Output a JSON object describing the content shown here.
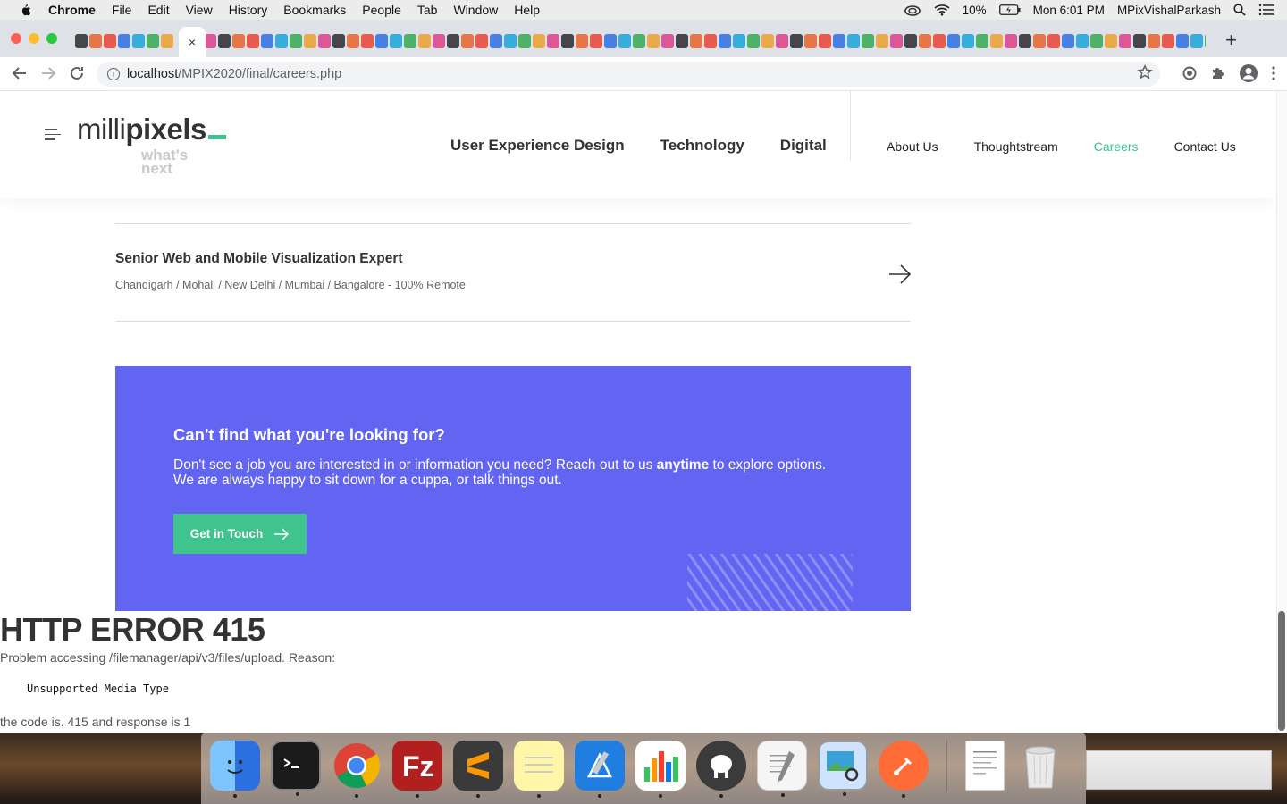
{
  "menubar": {
    "app": "Chrome",
    "items": [
      "File",
      "Edit",
      "View",
      "History",
      "Bookmarks",
      "People",
      "Tab",
      "Window",
      "Help"
    ],
    "battery": "10%",
    "clock": "Mon 6:01 PM",
    "user": "MPixVishalParkash"
  },
  "browser": {
    "active_tab_close": "×",
    "new_tab": "+",
    "url_host": "localhost",
    "url_path": "/MPIX2020/final/careers.php"
  },
  "site": {
    "logo_light": "milli",
    "logo_bold": "pixels",
    "tagline_1": "what's",
    "tagline_2": "next",
    "main_nav": [
      "User Experience Design",
      "Technology",
      "Digital"
    ],
    "sub_nav": [
      "About Us",
      "Thoughtstream",
      "Careers",
      "Contact Us"
    ],
    "active_sub_nav": "Careers",
    "accent": "#3cc48d",
    "cta_color": "#6264f2"
  },
  "job": {
    "title": "Senior Web and Mobile Visualization Expert",
    "locations": "Chandigarh / Mohali / New Delhi / Mumbai / Bangalore - 100% Remote"
  },
  "cta": {
    "title": "Can't find what you're looking for?",
    "text_before": "Don't see a job you are interested in or information you need? Reach out to us ",
    "text_bold": "anytime",
    "text_after": " to explore options. We are always happy to sit down for a cuppa, or talk things out.",
    "button": "Get in Touch"
  },
  "error": {
    "title": "HTTP ERROR 415",
    "problem": "Problem accessing /filemanager/api/v3/files/upload. Reason:",
    "reason": "Unsupported Media Type",
    "code_line": "the code is. 415 and response is 1"
  },
  "dock": [
    "finder-icon",
    "terminal-icon",
    "chrome-icon",
    "filezilla-icon",
    "sublime-icon",
    "notes-icon",
    "xcode-icon",
    "numbers-icon",
    "sequel-pro-icon",
    "textedit-icon",
    "preview-icon",
    "postman-icon",
    "document-icon",
    "trash-icon"
  ]
}
